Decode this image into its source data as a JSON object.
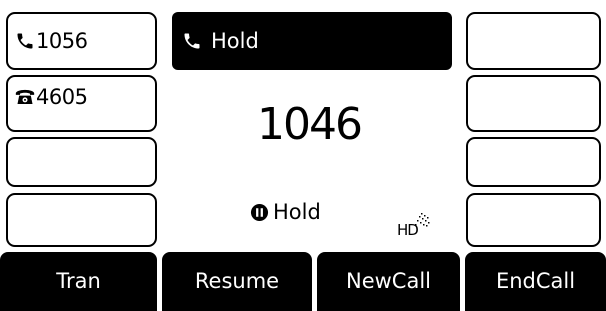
{
  "line_keys_left": [
    {
      "icon": "handset-icon",
      "label": "1056"
    },
    {
      "icon": "desk-phone-icon",
      "label": "4605"
    },
    {
      "icon": "",
      "label": ""
    },
    {
      "icon": "",
      "label": ""
    }
  ],
  "line_keys_right": [
    {
      "label": ""
    },
    {
      "label": ""
    },
    {
      "label": ""
    },
    {
      "label": ""
    }
  ],
  "call": {
    "title_icon": "handset-icon",
    "title": "Hold",
    "number": "1046",
    "status_icon": "hold-icon",
    "status": "Hold",
    "hd_label": "HD"
  },
  "softkeys": [
    {
      "label": "Tran"
    },
    {
      "label": "Resume"
    },
    {
      "label": "NewCall"
    },
    {
      "label": "EndCall"
    }
  ],
  "colors": {
    "background": "#ffffff",
    "foreground": "#000000",
    "inverse_text": "#ffffff"
  }
}
